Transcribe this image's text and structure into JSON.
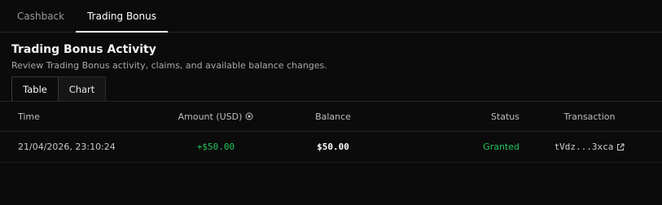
{
  "top_tabs": [
    {
      "label": "Cashback",
      "active": false
    },
    {
      "label": "Trading Bonus",
      "active": true
    }
  ],
  "section": {
    "title": "Trading Bonus Activity",
    "subtitle": "Review Trading Bonus activity, claims, and available balance changes."
  },
  "view_tabs": [
    {
      "label": "Table",
      "active": true
    },
    {
      "label": "Chart",
      "active": false
    }
  ],
  "table": {
    "headers": {
      "time": "Time",
      "amount": "Amount (USD)",
      "balance": "Balance",
      "status": "Status",
      "transaction": "Transaction"
    },
    "rows": [
      {
        "time": "21/04/2026, 23:10:24",
        "amount": "+$50.00",
        "balance": "$50.00",
        "status": "Granted",
        "transaction": "tVdz...3xca"
      }
    ]
  },
  "icons": {
    "amount_info": "info-circle-icon",
    "transaction_link": "external-link-icon"
  },
  "colors": {
    "background": "#0b0b0b",
    "positive": "#22c55e",
    "active_text": "#ffffff",
    "muted_text": "#9a9a9a"
  }
}
